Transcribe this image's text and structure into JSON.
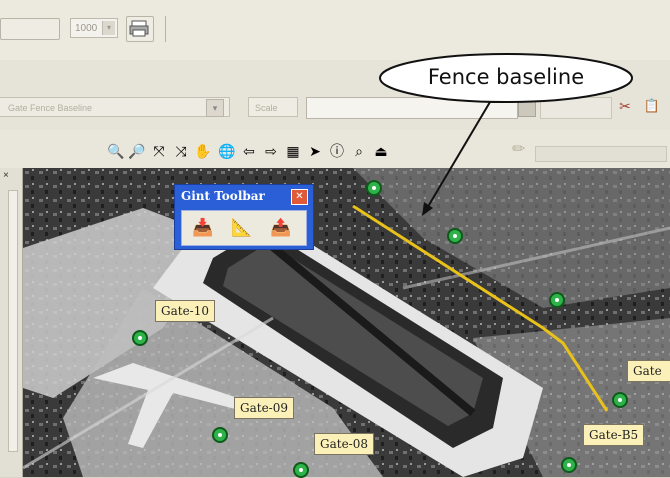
{
  "top_toolbar": {
    "combo_value": "1000",
    "combo_arrow": "▾"
  },
  "address_bar": {
    "text": "Gate Fence Baseline",
    "scale_text": "Scale"
  },
  "map_toolbar": {
    "tools": [
      {
        "name": "zoom-in-icon",
        "glyph": "🔍"
      },
      {
        "name": "zoom-out-icon",
        "glyph": "🔎"
      },
      {
        "name": "full-extent-icon",
        "glyph": "⤧"
      },
      {
        "name": "fixed-zoom-icon",
        "glyph": "⤨"
      },
      {
        "name": "pan-hand-icon",
        "glyph": "✋"
      },
      {
        "name": "globe-icon",
        "glyph": "🌐"
      },
      {
        "name": "back-extent-icon",
        "glyph": "⇦"
      },
      {
        "name": "forward-extent-icon",
        "glyph": "⇨"
      },
      {
        "name": "select-features-icon",
        "glyph": "▦"
      },
      {
        "name": "pointer-icon",
        "glyph": "➤"
      },
      {
        "name": "identify-icon",
        "glyph": "ⓘ"
      },
      {
        "name": "find-binoculars-icon",
        "glyph": "⌕"
      },
      {
        "name": "measure-icon",
        "glyph": "⏏"
      }
    ]
  },
  "callout": {
    "label": "Fence baseline"
  },
  "gint_toolbar": {
    "title": "Gint Toolbar",
    "close_glyph": "✕",
    "buttons": [
      {
        "name": "add-data-icon",
        "glyph": "📥"
      },
      {
        "name": "edit-points-icon",
        "glyph": "📐"
      },
      {
        "name": "export-icon",
        "glyph": "📤"
      }
    ]
  },
  "gates": [
    {
      "id": "gate-10",
      "label": "Gate-10"
    },
    {
      "id": "gate-09",
      "label": "Gate-09"
    },
    {
      "id": "gate-08",
      "label": "Gate-08"
    },
    {
      "id": "gate-b5",
      "label": "Gate-B5"
    },
    {
      "id": "gate-partial",
      "label": "Gate"
    }
  ],
  "colors": {
    "fence_line": "#e8c11a",
    "marker": "#2fb24a",
    "gint_titlebar": "#2b5fd8",
    "label_bg": "#fbf1b8"
  }
}
